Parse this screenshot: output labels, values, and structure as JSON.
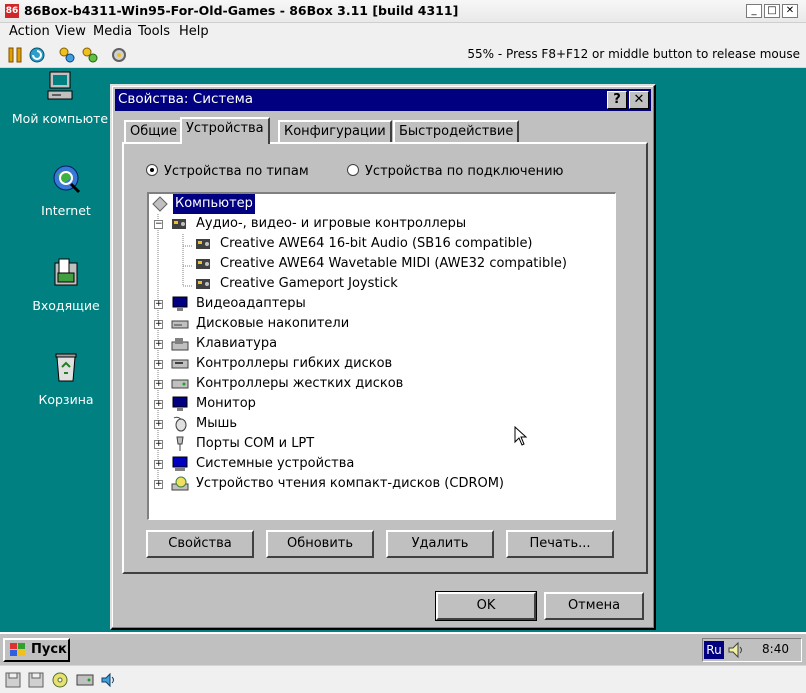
{
  "host": {
    "title": "86Box-b4311-Win95-For-Old-Games - 86Box 3.11 [build 4311]",
    "menu": [
      "Action",
      "View",
      "Media",
      "Tools",
      "Help"
    ],
    "status": "55% - Press F8+F12 or middle button to release mouse"
  },
  "desktop": {
    "icons": [
      {
        "label": "Мой компьюте",
        "icon": "my-computer-icon"
      },
      {
        "label": "Internet",
        "icon": "internet-icon"
      },
      {
        "label": "Входящие",
        "icon": "inbox-icon"
      },
      {
        "label": "Корзина",
        "icon": "recycle-bin-icon"
      }
    ]
  },
  "dialog": {
    "title": "Свойства: Система",
    "help_btn": "?",
    "close_btn": "✕",
    "tabs": [
      "Общие",
      "Устройства",
      "Конфигурации",
      "Быстродействие"
    ],
    "active_tab": "Устройства",
    "radio_by_type": "Устройства по типам",
    "radio_by_connection": "Устройства по подключению",
    "tree": [
      {
        "label": "Компьютер",
        "level": 0,
        "expander": "",
        "selected": true,
        "icon": "computer-icon"
      },
      {
        "label": "Аудио-, видео- и игровые контроллеры",
        "level": 1,
        "expander": "−",
        "icon": "sound-card-icon"
      },
      {
        "label": "Creative AWE64 16-bit Audio (SB16 compatible)",
        "level": 2,
        "expander": "",
        "icon": "sound-card-icon"
      },
      {
        "label": "Creative AWE64 Wavetable MIDI (AWE32 compatible)",
        "level": 2,
        "expander": "",
        "icon": "sound-card-icon"
      },
      {
        "label": "Creative Gameport Joystick",
        "level": 2,
        "expander": "",
        "icon": "sound-card-icon"
      },
      {
        "label": "Видеоадаптеры",
        "level": 1,
        "expander": "+",
        "icon": "display-adapter-icon"
      },
      {
        "label": "Дисковые накопители",
        "level": 1,
        "expander": "+",
        "icon": "disk-drive-icon"
      },
      {
        "label": "Клавиатура",
        "level": 1,
        "expander": "+",
        "icon": "keyboard-icon"
      },
      {
        "label": "Контроллеры гибких дисков",
        "level": 1,
        "expander": "+",
        "icon": "floppy-controller-icon"
      },
      {
        "label": "Контроллеры жестких дисков",
        "level": 1,
        "expander": "+",
        "icon": "hdd-controller-icon"
      },
      {
        "label": "Монитор",
        "level": 1,
        "expander": "+",
        "icon": "monitor-icon"
      },
      {
        "label": "Мышь",
        "level": 1,
        "expander": "+",
        "icon": "mouse-icon"
      },
      {
        "label": "Порты COM и LPT",
        "level": 1,
        "expander": "+",
        "icon": "port-icon"
      },
      {
        "label": "Системные устройства",
        "level": 1,
        "expander": "+",
        "icon": "system-device-icon"
      },
      {
        "label": "Устройство чтения компакт-дисков (CDROM)",
        "level": 1,
        "expander": "+",
        "icon": "cdrom-icon"
      }
    ],
    "buttons": [
      "Свойства",
      "Обновить",
      "Удалить",
      "Печать..."
    ],
    "ok": "OK",
    "cancel": "Отмена"
  },
  "taskbar": {
    "start": "Пуск",
    "lang": "Ru",
    "clock": "8:40"
  },
  "colors": {
    "desktop": "#008080",
    "titlebar": "#000080",
    "face": "#c0c0c0",
    "selection": "#000080"
  }
}
